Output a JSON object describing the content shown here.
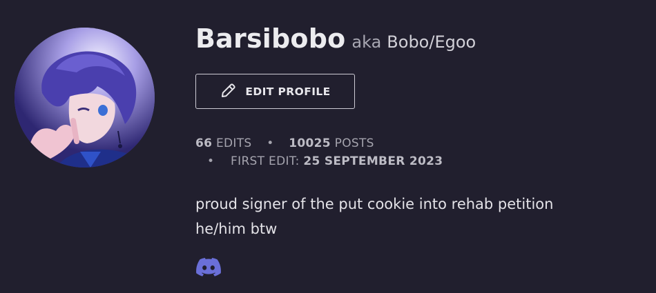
{
  "profile": {
    "username": "Barsibobo",
    "aka_label": "aka",
    "aka_name": "Bobo/Egoo",
    "edit_button_label": "EDIT PROFILE",
    "avatar_icon": "anime-character-avatar"
  },
  "stats": {
    "edits_count": "66",
    "edits_label": "EDITS",
    "posts_count": "10025",
    "posts_label": "POSTS",
    "first_edit_label": "FIRST EDIT:",
    "first_edit_date": "25 SEPTEMBER 2023",
    "separator": "•"
  },
  "bio": {
    "line1": "proud signer of the put cookie into rehab petition",
    "line2": "he/him btw"
  },
  "social": {
    "discord_icon": "discord-icon",
    "discord_color": "#6a6fd8"
  },
  "colors": {
    "background": "#211f2e",
    "text_primary": "#ececef",
    "text_muted": "#a5a4ae"
  }
}
